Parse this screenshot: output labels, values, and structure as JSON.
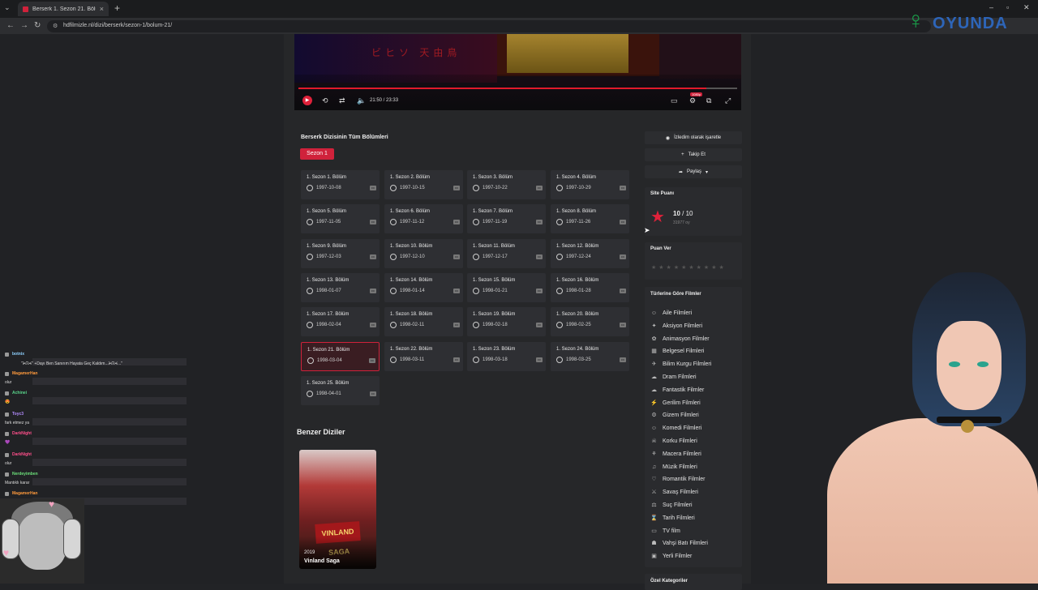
{
  "browser": {
    "tab_title": "Berserk 1. Sezon 21. Bölüm | D...",
    "url": "hdfilmizle.nl/dizi/berserk/sezon-1/bolum-21/"
  },
  "player": {
    "time": "21:50 / 23:33",
    "hd_badge": "1080p",
    "progress_percent": 93
  },
  "episodes": {
    "title": "Berserk Dizisinin Tüm Bölümleri",
    "season_label": "Sezon 1",
    "active_index": 20,
    "items": [
      {
        "name": "1. Sezon 1. Bölüm",
        "date": "1997-10-08"
      },
      {
        "name": "1. Sezon 2. Bölüm",
        "date": "1997-10-15"
      },
      {
        "name": "1. Sezon 3. Bölüm",
        "date": "1997-10-22"
      },
      {
        "name": "1. Sezon 4. Bölüm",
        "date": "1997-10-29"
      },
      {
        "name": "1. Sezon 5. Bölüm",
        "date": "1997-11-05"
      },
      {
        "name": "1. Sezon 6. Bölüm",
        "date": "1997-11-12"
      },
      {
        "name": "1. Sezon 7. Bölüm",
        "date": "1997-11-19"
      },
      {
        "name": "1. Sezon 8. Bölüm",
        "date": "1997-11-26"
      },
      {
        "name": "1. Sezon 9. Bölüm",
        "date": "1997-12-03"
      },
      {
        "name": "1. Sezon 10. Bölüm",
        "date": "1997-12-10"
      },
      {
        "name": "1. Sezon 11. Bölüm",
        "date": "1997-12-17"
      },
      {
        "name": "1. Sezon 12. Bölüm",
        "date": "1997-12-24"
      },
      {
        "name": "1. Sezon 13. Bölüm",
        "date": "1998-01-07"
      },
      {
        "name": "1. Sezon 14. Bölüm",
        "date": "1998-01-14"
      },
      {
        "name": "1. Sezon 15. Bölüm",
        "date": "1998-01-21"
      },
      {
        "name": "1. Sezon 16. Bölüm",
        "date": "1998-01-28"
      },
      {
        "name": "1. Sezon 17. Bölüm",
        "date": "1998-02-04"
      },
      {
        "name": "1. Sezon 18. Bölüm",
        "date": "1998-02-11"
      },
      {
        "name": "1. Sezon 19. Bölüm",
        "date": "1998-02-18"
      },
      {
        "name": "1. Sezon 20. Bölüm",
        "date": "1998-02-25"
      },
      {
        "name": "1. Sezon 21. Bölüm",
        "date": "1998-03-04"
      },
      {
        "name": "1. Sezon 22. Bölüm",
        "date": "1998-03-11"
      },
      {
        "name": "1. Sezon 23. Bölüm",
        "date": "1998-03-18"
      },
      {
        "name": "1. Sezon 24. Bölüm",
        "date": "1998-03-25"
      },
      {
        "name": "1. Sezon 25. Bölüm",
        "date": "1998-04-01"
      }
    ]
  },
  "similar": {
    "title": "Benzer Diziler",
    "items": [
      {
        "year": "2019",
        "name": "Vinland Saga",
        "poster_text": "VINLAND SAGA"
      }
    ]
  },
  "sidebar": {
    "watched_label": "İzledim olarak işaretle",
    "follow_label": "Takip Et",
    "share_label": "Paylaş",
    "site_score_title": "Site Puanı",
    "score": "10",
    "score_max": "/ 10",
    "votes": "31977 oy",
    "rate_title": "Puan Ver",
    "rate_stars": "★★★★★★★★★★",
    "genres_title": "Türlerine Göre Filmler",
    "genres": [
      {
        "label": "Aile Filmleri",
        "icon": "family-icon"
      },
      {
        "label": "Aksiyon Filmleri",
        "icon": "action-icon"
      },
      {
        "label": "Animasyon Filmler",
        "icon": "animation-icon"
      },
      {
        "label": "Belgesel Filmleri",
        "icon": "documentary-icon"
      },
      {
        "label": "Bilim Kurgu Filmleri",
        "icon": "rocket-icon"
      },
      {
        "label": "Dram Filmleri",
        "icon": "drama-icon"
      },
      {
        "label": "Fantastik Filmler",
        "icon": "fantasy-icon"
      },
      {
        "label": "Gerilim Filmleri",
        "icon": "thriller-icon"
      },
      {
        "label": "Gizem Filmleri",
        "icon": "mystery-icon"
      },
      {
        "label": "Komedi Filmleri",
        "icon": "comedy-icon"
      },
      {
        "label": "Korku Filmleri",
        "icon": "horror-icon"
      },
      {
        "label": "Macera Filmleri",
        "icon": "adventure-icon"
      },
      {
        "label": "Müzik Filmleri",
        "icon": "music-icon"
      },
      {
        "label": "Romantik Filmler",
        "icon": "heart-icon"
      },
      {
        "label": "Savaş Filmleri",
        "icon": "war-icon"
      },
      {
        "label": "Suç Filmleri",
        "icon": "crime-icon"
      },
      {
        "label": "Tarih Filmleri",
        "icon": "history-icon"
      },
      {
        "label": "TV film",
        "icon": "tv-icon"
      },
      {
        "label": "Vahşi Batı Filmleri",
        "icon": "western-icon"
      },
      {
        "label": "Yerli Filmler",
        "icon": "local-icon"
      }
    ],
    "special_title": "Özel Kategoriler"
  },
  "stream_chat": [
    {
      "nick": "botnix",
      "msg": "\"ᗒᗣᗕ\" +Dayı Ben Sanırım Hayata Geç Kaldım...ᗒᗣᗕ...\"",
      "color": "#8fd1ff"
    },
    {
      "nick": "MagamerHan",
      "msg": "olur",
      "color": "#ff9a3c"
    },
    {
      "nick": "Achinei",
      "msg": "😍",
      "color": "#59d68b"
    },
    {
      "nick": "Toyc3",
      "msg": "fark etmez ya",
      "color": "#b48cff"
    },
    {
      "nick": "DarkNight",
      "msg": "💜",
      "color": "#ff4f8b"
    },
    {
      "nick": "DarkNight",
      "msg": "olur",
      "color": "#ff4f8b"
    },
    {
      "nick": "Nerdeyimben",
      "msg": "Mantıklı karar",
      "color": "#6ce07a"
    },
    {
      "nick": "MagamerHan",
      "msg": "",
      "color": "#ff9a3c"
    }
  ],
  "overlay": {
    "logo_text": "OYUNDA",
    "colors": {
      "accent": "#d0223b",
      "logo_green": "#1aa04a",
      "logo_blue": "#2e6fd1"
    }
  }
}
